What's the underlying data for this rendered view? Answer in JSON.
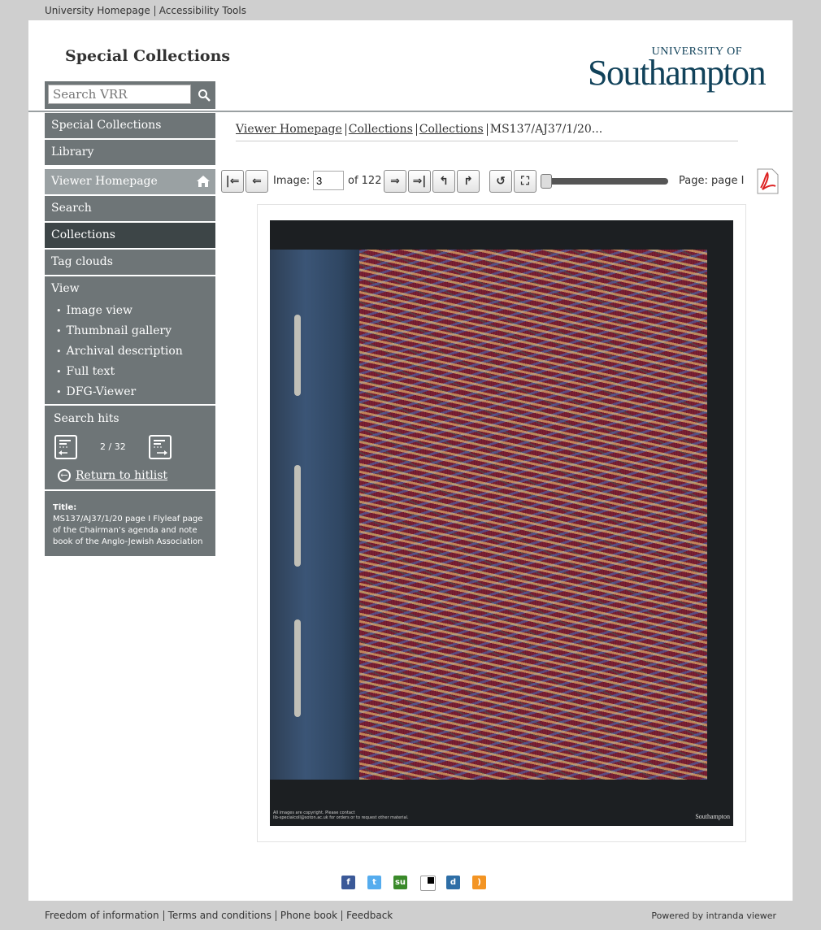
{
  "topbar": {
    "links": [
      "University Homepage",
      "Accessibility Tools"
    ]
  },
  "header": {
    "site_title": "Special Collections",
    "logo_line1": "UNIVERSITY OF",
    "logo_line2": "Southampton",
    "search_placeholder": "Search VRR"
  },
  "sidebar": {
    "nav": [
      "Special Collections",
      "Library"
    ],
    "viewer_homepage": "Viewer Homepage",
    "viewer_items": [
      "Search",
      "Collections",
      "Tag clouds"
    ],
    "view_title": "View",
    "view_items": [
      "Image view",
      "Thumbnail gallery",
      "Archival description",
      "Full text",
      "DFG-Viewer"
    ],
    "search_hits": {
      "title": "Search hits",
      "count": "2 / 32",
      "return_label": "Return to hitlist"
    },
    "title_label": "Title:",
    "title_value": "MS137/AJ37/1/20 page I Flyleaf page of the Chairman’s agenda and note book of the Anglo-Jewish Association"
  },
  "breadcrumb": [
    "Viewer Homepage",
    "Collections",
    "Collections",
    "MS137/AJ37/1/20..."
  ],
  "toolbar": {
    "image_label": "Image:",
    "image_value": "3",
    "of_label": "of 122",
    "page_label": "Page: page I",
    "slider_position": 0.0
  },
  "scan": {
    "footer_text_1": "All images are copyright. Please contact",
    "footer_text_2": "lib-specialcoll@soton.ac.uk for orders or to request other material.",
    "watermark": "Southampton"
  },
  "social": [
    "facebook-icon",
    "twitter-icon",
    "stumbleupon-icon",
    "delicious-icon",
    "digg-icon",
    "rss-icon"
  ],
  "footer": {
    "links": [
      "Freedom of information",
      "Terms and conditions",
      "Phone book",
      "Feedback"
    ],
    "powered": "Powered by intranda viewer"
  }
}
